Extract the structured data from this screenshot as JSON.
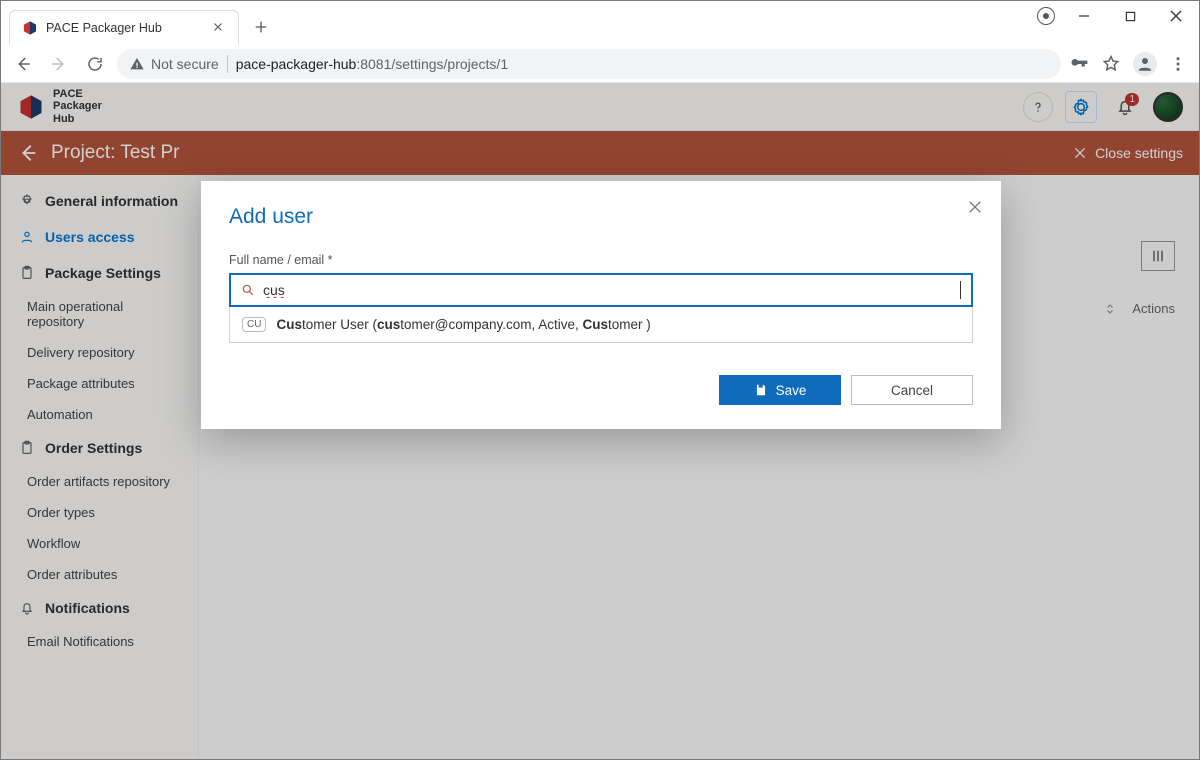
{
  "browser": {
    "tab_title": "PACE Packager Hub",
    "not_secure": "Not secure",
    "host": "pace-packager-hub",
    "port_path": ":8081/settings/projects/1"
  },
  "app_header": {
    "product_line1": "PACE",
    "product_line2": "Packager",
    "product_line3": "Hub",
    "badge_count": "1"
  },
  "project_bar": {
    "title": "Project: Test Pr",
    "close": "Close settings"
  },
  "sidebar": {
    "general": "General information",
    "users_access": "Users access",
    "package_settings": "Package Settings",
    "pkg_items": [
      "Main operational repository",
      "Delivery repository",
      "Package attributes",
      "Automation"
    ],
    "order_settings": "Order Settings",
    "order_items": [
      "Order artifacts repository",
      "Order types",
      "Workflow",
      "Order attributes"
    ],
    "notifications": "Notifications",
    "notif_items": [
      "Email Notifications"
    ]
  },
  "content": {
    "actions": "Actions"
  },
  "modal": {
    "title": "Add user",
    "field_label": "Full name / email *",
    "search_value": "cus",
    "suggestion": {
      "chip": "CU",
      "pre": "Cus",
      "mid1": "tomer User (",
      "bold2": "cus",
      "mid2": "tomer@company.com, Active, ",
      "bold3": "Cus",
      "post": "tomer )"
    },
    "save": "Save",
    "cancel": "Cancel"
  }
}
